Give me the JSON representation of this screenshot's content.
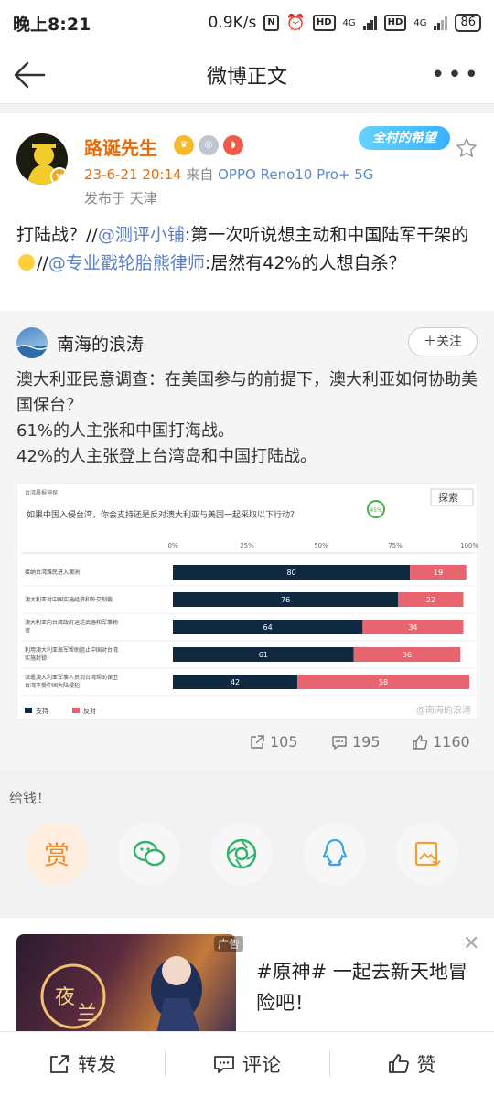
{
  "status_bar": {
    "time": "晚上8:21",
    "speed": "0.9K/s",
    "battery": "86",
    "hd1": "HD",
    "hd2": "HD",
    "net1": "4G",
    "net2": "4G"
  },
  "nav": {
    "title": "微博正文"
  },
  "post": {
    "author": "路诞先生",
    "topic_badge": "全村的希望",
    "time": "23-6-21 20:14",
    "source_prefix": "来自",
    "device": "OPPO Reno10 Pro+ 5G",
    "location": "发布于 天津",
    "text_1": "打陆战？//",
    "mention_1": "@测评小铺",
    "text_2": ":第一次听说想主动和中国陆军干架的",
    "text_3": "//",
    "mention_2": "@专业戳轮胎熊律师",
    "text_4": ":居然有42%的人想自杀？"
  },
  "retweet": {
    "author": "南海的浪涛",
    "follow_label": "＋关注",
    "line_1": "澳大利亚民意调查：在美国参与的前提下，澳大利亚如何协助美国保台？",
    "line_2": "61%的人主张和中国打海战。",
    "line_3": "42%的人主张登上台湾岛和中国打陆战。",
    "reposts": "105",
    "comments": "195",
    "likes": "1160"
  },
  "chart_data": {
    "type": "bar",
    "stacked": true,
    "orientation": "horizontal",
    "source_label": "台湾晨报神探",
    "title": "如果中国入侵台湾，你会支持还是反对澳大利亚与美国一起采取以下行动？",
    "badge": "45%",
    "search_label": "探索",
    "watermark": "@南海的浪涛",
    "x_ticks": [
      "0%",
      "25%",
      "50%",
      "75%",
      "100%"
    ],
    "xlim": [
      0,
      100
    ],
    "categories": [
      "接纳台湾难民进入澳洲",
      "澳大利亚对中国实施经济和外交制裁",
      "澳大利亚向台湾政府运送武器和军事物资",
      "利用澳大利亚海军帮助阻止中国对台湾实施封锁",
      "派遣澳大利亚军事人员到台湾帮助保卫台湾不受中国大陆侵犯"
    ],
    "series": [
      {
        "name": "支持",
        "values": [
          80,
          76,
          64,
          61,
          42
        ],
        "color": "#0f2a40"
      },
      {
        "name": "反对",
        "values": [
          19,
          22,
          34,
          36,
          58
        ],
        "color": "#e8646e"
      }
    ]
  },
  "tip": {
    "label": "给钱！",
    "reward": "赏"
  },
  "ad": {
    "tag": "广告",
    "text": "#原神# 一起去新天地冒险吧！"
  },
  "bottom": {
    "repost": "转发",
    "comment": "评论",
    "like": "赞"
  }
}
